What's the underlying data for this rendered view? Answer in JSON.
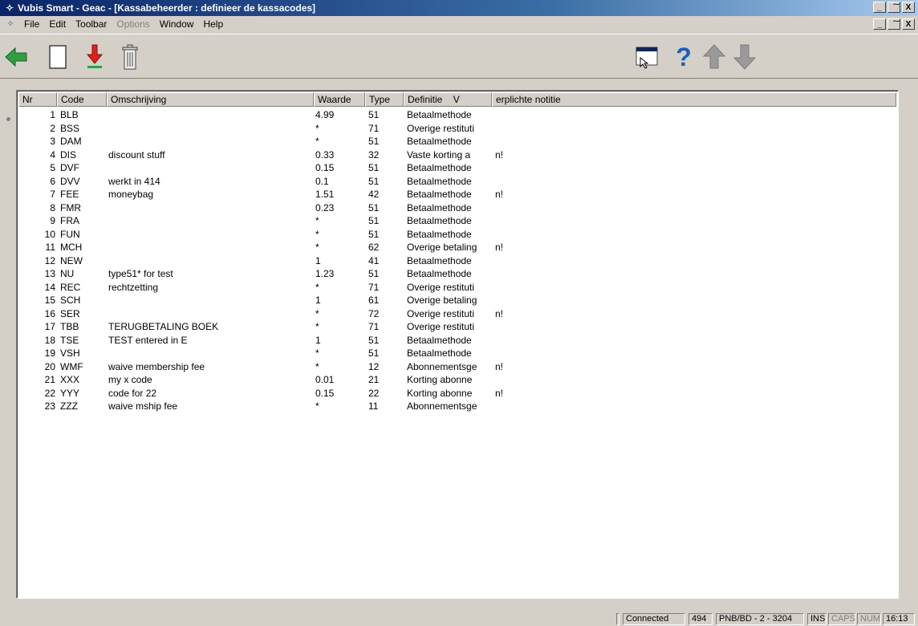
{
  "window": {
    "title": "Vubis Smart - Geac - [Kassabeheerder : definieer de kassacodes]",
    "controls": [
      "_",
      "͠",
      "X"
    ]
  },
  "menu": {
    "items": [
      {
        "label": "File",
        "enabled": true
      },
      {
        "label": "Edit",
        "enabled": true
      },
      {
        "label": "Toolbar",
        "enabled": true
      },
      {
        "label": "Options",
        "enabled": false
      },
      {
        "label": "Window",
        "enabled": true
      },
      {
        "label": "Help",
        "enabled": true
      }
    ]
  },
  "toolbar": {
    "left": [
      "back-arrow-icon",
      "new-document-icon",
      "download-arrow-icon",
      "trash-icon"
    ],
    "right": [
      "select-window-icon",
      "help-icon",
      "up-arrow-icon",
      "down-arrow-icon"
    ]
  },
  "grid": {
    "headers": [
      "Nr",
      "Code",
      "Omschrijving",
      "Waarde",
      "Type",
      "Definitie    V",
      "erplichte notitie"
    ],
    "rows": [
      [
        "1",
        "BLB",
        "",
        "4.99",
        "51",
        "Betaalmethode",
        ""
      ],
      [
        "2",
        "BSS",
        "",
        "*",
        "71",
        "Overige restituti",
        ""
      ],
      [
        "3",
        "DAM",
        "",
        "*",
        "51",
        "Betaalmethode",
        ""
      ],
      [
        "4",
        "DIS",
        "discount stuff",
        "0.33",
        "32",
        "Vaste korting a",
        "n!"
      ],
      [
        "5",
        "DVF",
        "",
        "0.15",
        "51",
        "Betaalmethode",
        ""
      ],
      [
        "6",
        "DVV",
        "werkt in 414",
        "0.1",
        "51",
        "Betaalmethode",
        ""
      ],
      [
        "7",
        "FEE",
        "moneybag",
        "1.51",
        "42",
        "Betaalmethode",
        "n!"
      ],
      [
        "8",
        "FMR",
        "",
        "0.23",
        "51",
        "Betaalmethode",
        ""
      ],
      [
        "9",
        "FRA",
        "",
        "*",
        "51",
        "Betaalmethode",
        ""
      ],
      [
        "10",
        "FUN",
        "",
        "*",
        "51",
        "Betaalmethode",
        ""
      ],
      [
        "11",
        "MCH",
        "",
        "*",
        "62",
        "Overige betaling",
        "n!"
      ],
      [
        "12",
        "NEW",
        "",
        "1",
        "41",
        "Betaalmethode",
        ""
      ],
      [
        "13",
        "NU",
        "type51* for test",
        "1.23",
        "51",
        "Betaalmethode",
        ""
      ],
      [
        "14",
        "REC",
        "rechtzetting",
        "*",
        "71",
        "Overige restituti",
        ""
      ],
      [
        "15",
        "SCH",
        "",
        "1",
        "61",
        "Overige betaling",
        ""
      ],
      [
        "16",
        "SER",
        "",
        "*",
        "72",
        "Overige restituti",
        "n!"
      ],
      [
        "17",
        "TBB",
        "TERUGBETALING BOEK",
        "*",
        "71",
        "Overige restituti",
        ""
      ],
      [
        "18",
        "TSE",
        "TEST entered in E",
        "1",
        "51",
        "Betaalmethode",
        ""
      ],
      [
        "19",
        "VSH",
        "",
        "*",
        "51",
        "Betaalmethode",
        ""
      ],
      [
        "20",
        "WMF",
        "waive membership fee",
        "*",
        "12",
        "Abonnementsge",
        "n!"
      ],
      [
        "21",
        "XXX",
        "my x code",
        "0.01",
        "21",
        "Korting abonne",
        ""
      ],
      [
        "22",
        "YYY",
        "code for 22",
        "0.15",
        "22",
        "Korting abonne",
        "n!"
      ],
      [
        "23",
        "ZZZ",
        "waive mship fee",
        "*",
        "11",
        "Abonnementsge",
        ""
      ]
    ]
  },
  "status": {
    "connection": "Connected",
    "count": "494",
    "location": "PNB/BD - 2 - 3204",
    "ins": "INS",
    "caps": "CAPS",
    "num": "NUM",
    "time": "16:13"
  },
  "colors": {
    "titlebar": "#0a246a",
    "window_bg": "#d4d0c8",
    "back_arrow": "#2ea043",
    "download_arrow": "#e0201b"
  }
}
